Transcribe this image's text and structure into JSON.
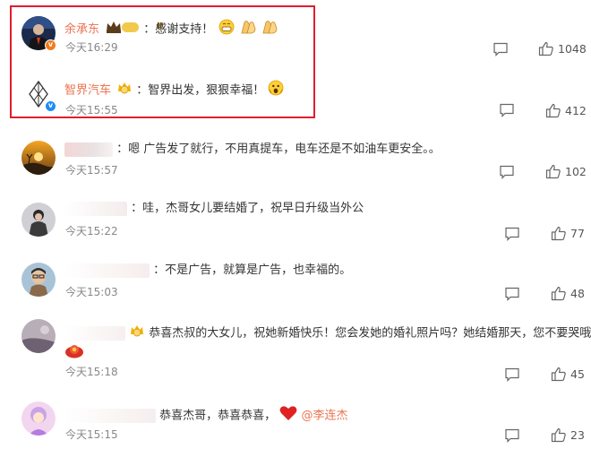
{
  "comments": [
    {
      "username": "余承东",
      "text": "：感谢支持！",
      "time": "今天16:29",
      "likes": "1048",
      "badge_level": "Ⅱ",
      "emoji": [
        "grin-icon",
        "clap-icon",
        "clap-icon"
      ]
    },
    {
      "username": "智界汽车",
      "text": "：智界出发，狠狠幸福！",
      "time": "今天15:55",
      "likes": "412",
      "emoji": [
        "wow-icon"
      ]
    },
    {
      "text": "：嗯 广告发了就行，不用真提车，电车还是不如油车更安全。。",
      "time": "今天15:57",
      "likes": "102"
    },
    {
      "text": "：哇，杰哥女儿要结婚了，祝早日升级当外公",
      "time": "今天15:22",
      "likes": "77"
    },
    {
      "text": "：不是广告，就算是广告，也幸福的。",
      "time": "今天15:03",
      "likes": "48"
    },
    {
      "text": "恭喜杰叔的大女儿，祝她新婚快乐！您会发她的婚礼照片吗？她结婚那天，您不要哭哦",
      "time": "今天15:18",
      "likes": "45"
    },
    {
      "text": "恭喜杰哥，恭喜恭喜，",
      "mention": "@李连杰",
      "time": "今天15:15",
      "likes": "23"
    }
  ],
  "colors": {
    "highlight_border": "#e11d2e",
    "username": "#eb7350",
    "verified_orange": "#f17b1c",
    "verified_blue": "#1e8cf5"
  }
}
